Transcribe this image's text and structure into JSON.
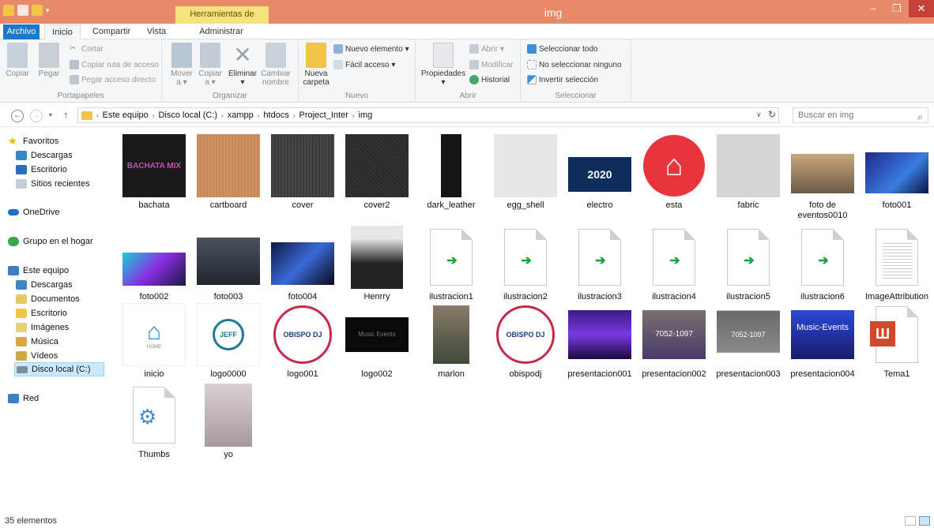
{
  "window": {
    "title": "img",
    "context_tab_header": "Herramientas de imagen",
    "minimize_glyph": "‒",
    "maximize_glyph": "❐",
    "close_glyph": "✕"
  },
  "tabs": {
    "archivo": "Archivo",
    "inicio": "Inicio",
    "compartir": "Compartir",
    "vista": "Vista",
    "administrar": "Administrar"
  },
  "ribbon": {
    "portapapeles": {
      "label": "Portapapeles",
      "copiar": "Copiar",
      "pegar": "Pegar",
      "cortar": "Cortar",
      "copiar_ruta": "Copiar ruta de acceso",
      "pegar_acceso": "Pegar acceso directo"
    },
    "organizar": {
      "label": "Organizar",
      "mover": "Mover",
      "mover2": "a ▾",
      "copiar": "Copiar",
      "copiar2": "a ▾",
      "eliminar": "Eliminar",
      "eliminar2": "▾",
      "cambiar": "Cambiar",
      "cambiar2": "nombre"
    },
    "nuevo": {
      "label": "Nuevo",
      "nueva_carpeta": "Nueva",
      "nueva_carpeta2": "carpeta",
      "nuevo_elemento": "Nuevo elemento ▾",
      "facil_acceso": "Fácil acceso ▾"
    },
    "abrir": {
      "label": "Abrir",
      "propiedades": "Propiedades",
      "propiedades2": "▾",
      "abrir": "Abrir ▾",
      "modificar": "Modificar",
      "historial": "Historial"
    },
    "seleccionar": {
      "label": "Seleccionar",
      "todo": "Seleccionar todo",
      "ninguno": "No seleccionar ninguno",
      "invertir": "Invertir selección"
    }
  },
  "address": {
    "crumbs": [
      "Este equipo",
      "Disco local (C:)",
      "xampp",
      "htdocs",
      "Project_Inter",
      "img"
    ],
    "search_placeholder": "Buscar en img",
    "separator": "›"
  },
  "nav": {
    "favoritos": "Favoritos",
    "descargas": "Descargas",
    "escritorio": "Escritorio",
    "sitios": "Sitios recientes",
    "onedrive": "OneDrive",
    "grupo": "Grupo en el hogar",
    "este_equipo": "Este equipo",
    "descargas2": "Descargas",
    "documentos": "Documentos",
    "escritorio2": "Escritorio",
    "imagenes": "Imágenes",
    "musica": "Música",
    "videos": "Vídeos",
    "disco": "Disco local (C:)",
    "red": "Red"
  },
  "files": [
    {
      "name": "bachata",
      "icon": "image-thumbnail"
    },
    {
      "name": "cartboard",
      "icon": "image-thumbnail"
    },
    {
      "name": "cover",
      "icon": "image-thumbnail"
    },
    {
      "name": "cover2",
      "icon": "image-thumbnail"
    },
    {
      "name": "dark_leather",
      "icon": "image-thumbnail"
    },
    {
      "name": "egg_shell",
      "icon": "image-thumbnail"
    },
    {
      "name": "electro",
      "icon": "image-thumbnail"
    },
    {
      "name": "esta",
      "icon": "image-thumbnail"
    },
    {
      "name": "fabric",
      "icon": "image-thumbnail"
    },
    {
      "name": "foto de eventos0010",
      "icon": "image-thumbnail"
    },
    {
      "name": "foto001",
      "icon": "image-thumbnail"
    },
    {
      "name": "foto002",
      "icon": "image-thumbnail"
    },
    {
      "name": "foto003",
      "icon": "image-thumbnail"
    },
    {
      "name": "foto004",
      "icon": "image-thumbnail"
    },
    {
      "name": "Henrry",
      "icon": "image-thumbnail"
    },
    {
      "name": "ilustracion1",
      "icon": "shortcut-file-icon"
    },
    {
      "name": "ilustracion2",
      "icon": "shortcut-file-icon"
    },
    {
      "name": "ilustracion3",
      "icon": "shortcut-file-icon"
    },
    {
      "name": "ilustracion4",
      "icon": "shortcut-file-icon"
    },
    {
      "name": "ilustracion5",
      "icon": "shortcut-file-icon"
    },
    {
      "name": "ilustracion6",
      "icon": "shortcut-file-icon"
    },
    {
      "name": "ImageAttribution",
      "icon": "text-file-icon"
    },
    {
      "name": "inicio",
      "icon": "image-thumbnail"
    },
    {
      "name": "logo0000",
      "icon": "image-thumbnail"
    },
    {
      "name": "logo001",
      "icon": "image-thumbnail"
    },
    {
      "name": "logo002",
      "icon": "image-thumbnail"
    },
    {
      "name": "marlon",
      "icon": "image-thumbnail"
    },
    {
      "name": "obispodj",
      "icon": "image-thumbnail"
    },
    {
      "name": "presentacion001",
      "icon": "image-thumbnail"
    },
    {
      "name": "presentacion002",
      "icon": "image-thumbnail"
    },
    {
      "name": "presentacion003",
      "icon": "image-thumbnail"
    },
    {
      "name": "presentacion004",
      "icon": "image-thumbnail"
    },
    {
      "name": "Tema1",
      "icon": "office-document-icon"
    },
    {
      "name": "Thumbs",
      "icon": "system-file-icon"
    },
    {
      "name": "yo",
      "icon": "image-thumbnail"
    }
  ],
  "thumb_text": {
    "bachata": "BACHATA MIX",
    "electro": "2020",
    "inicio": "HOME",
    "logo0000": "JEFF",
    "obispo": "OBISPO DJ",
    "music_events": "Music Events",
    "music_events2": "Music-Events",
    "tel": "7052-1097"
  },
  "status": {
    "count": "35 elementos"
  },
  "colors": {
    "titlebar": "#e8896a",
    "accent": "#1979ca",
    "context_tab": "#f6e27a",
    "selected_nav": "#cce8ff"
  }
}
